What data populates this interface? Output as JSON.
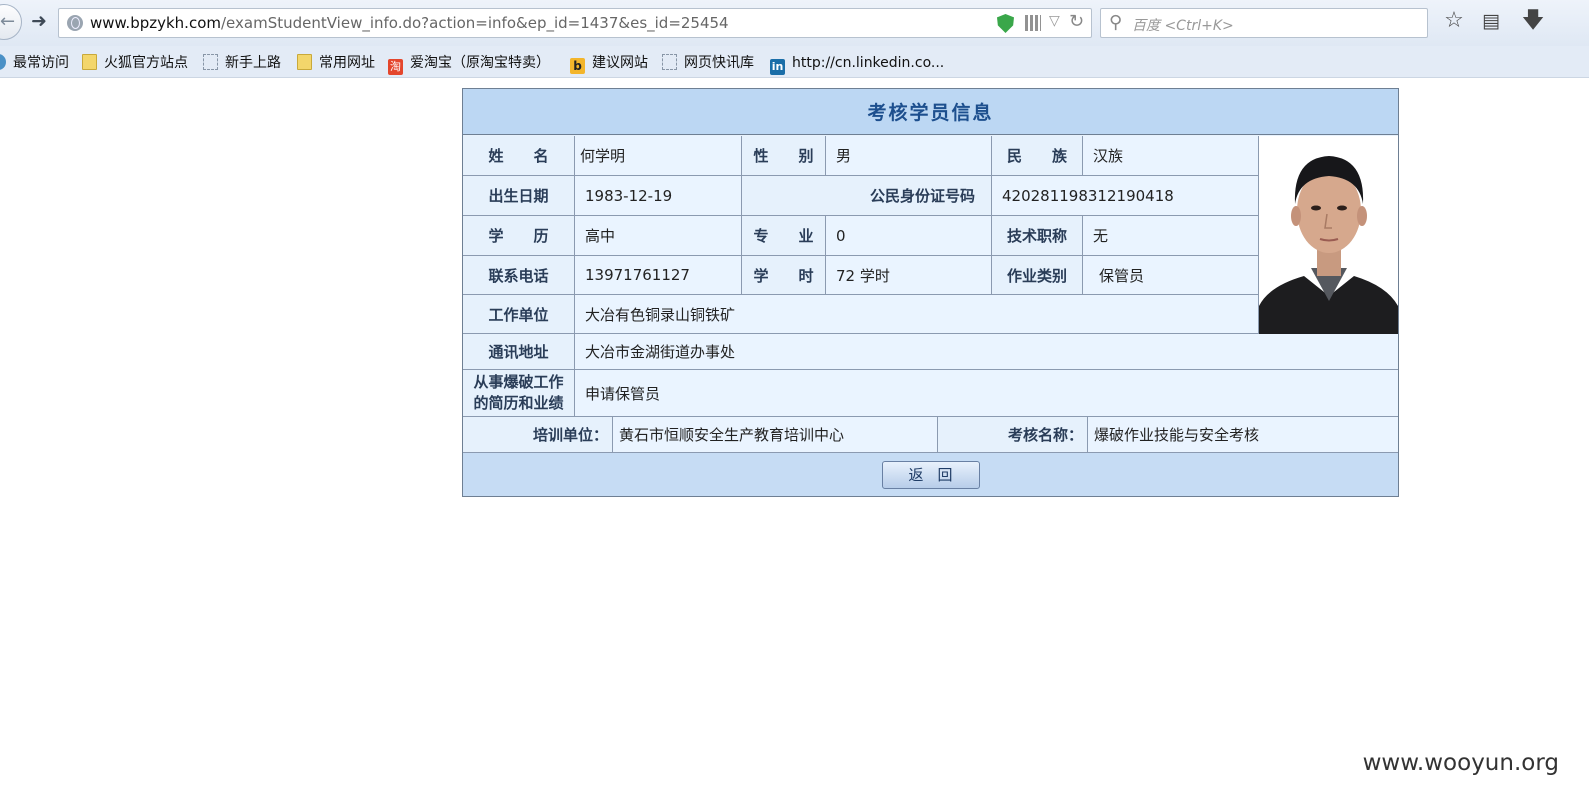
{
  "browser": {
    "url_domain": "www.bpzykh.com",
    "url_path": "/examStudentView_info.do?action=info&ep_id=1437&es_id=25454",
    "search_placeholder": "百度 <Ctrl+K>"
  },
  "bookmarks": [
    {
      "label": "最常访问",
      "icon": "ie-icon"
    },
    {
      "label": "火狐官方站点",
      "icon": "folder-icon"
    },
    {
      "label": "新手上路",
      "icon": "page-icon"
    },
    {
      "label": "常用网址",
      "icon": "folder-icon"
    },
    {
      "label": "爱淘宝（原淘宝特卖）",
      "icon": "taobao-icon"
    },
    {
      "label": "建议网站",
      "icon": "bing-icon"
    },
    {
      "label": "网页快讯库",
      "icon": "page-icon"
    },
    {
      "label": "http://cn.linkedin.co...",
      "icon": "linkedin-icon"
    }
  ],
  "student": {
    "title": "考核学员信息",
    "name_label": "姓　　名",
    "name": "何学明",
    "gender_label": "性　　别",
    "gender": "男",
    "ethnicity_label": "民　　族",
    "ethnicity": "汉族",
    "birth_label": "出生日期",
    "birth": "1983-12-19",
    "id_label": "公民身份证号码",
    "id_number": "420281198312190418",
    "education_label": "学　　历",
    "education": "高中",
    "major_label": "专　　业",
    "major": "0",
    "tech_title_label": "技术职称",
    "tech_title": "无",
    "phone_label": "联系电话",
    "phone": "13971761127",
    "hours_label": "学　　时",
    "hours": "72 学时",
    "job_type_label": "作业类别",
    "job_type": "保管员",
    "employer_label": "工作单位",
    "employer": "大冶有色铜录山铜铁矿",
    "address_label": "通讯地址",
    "address": "大冶市金湖街道办事处",
    "experience_label_1": "从事爆破工作",
    "experience_label_2": "的简历和业绩",
    "experience": "申请保管员",
    "training_unit_label": "培训单位：",
    "training_unit": "黄石市恒顺安全生产教育培训中心",
    "exam_name_label": "考核名称：",
    "exam_name": "爆破作业技能与安全考核",
    "back_button": "返回"
  },
  "watermark": "www.wooyun.org"
}
